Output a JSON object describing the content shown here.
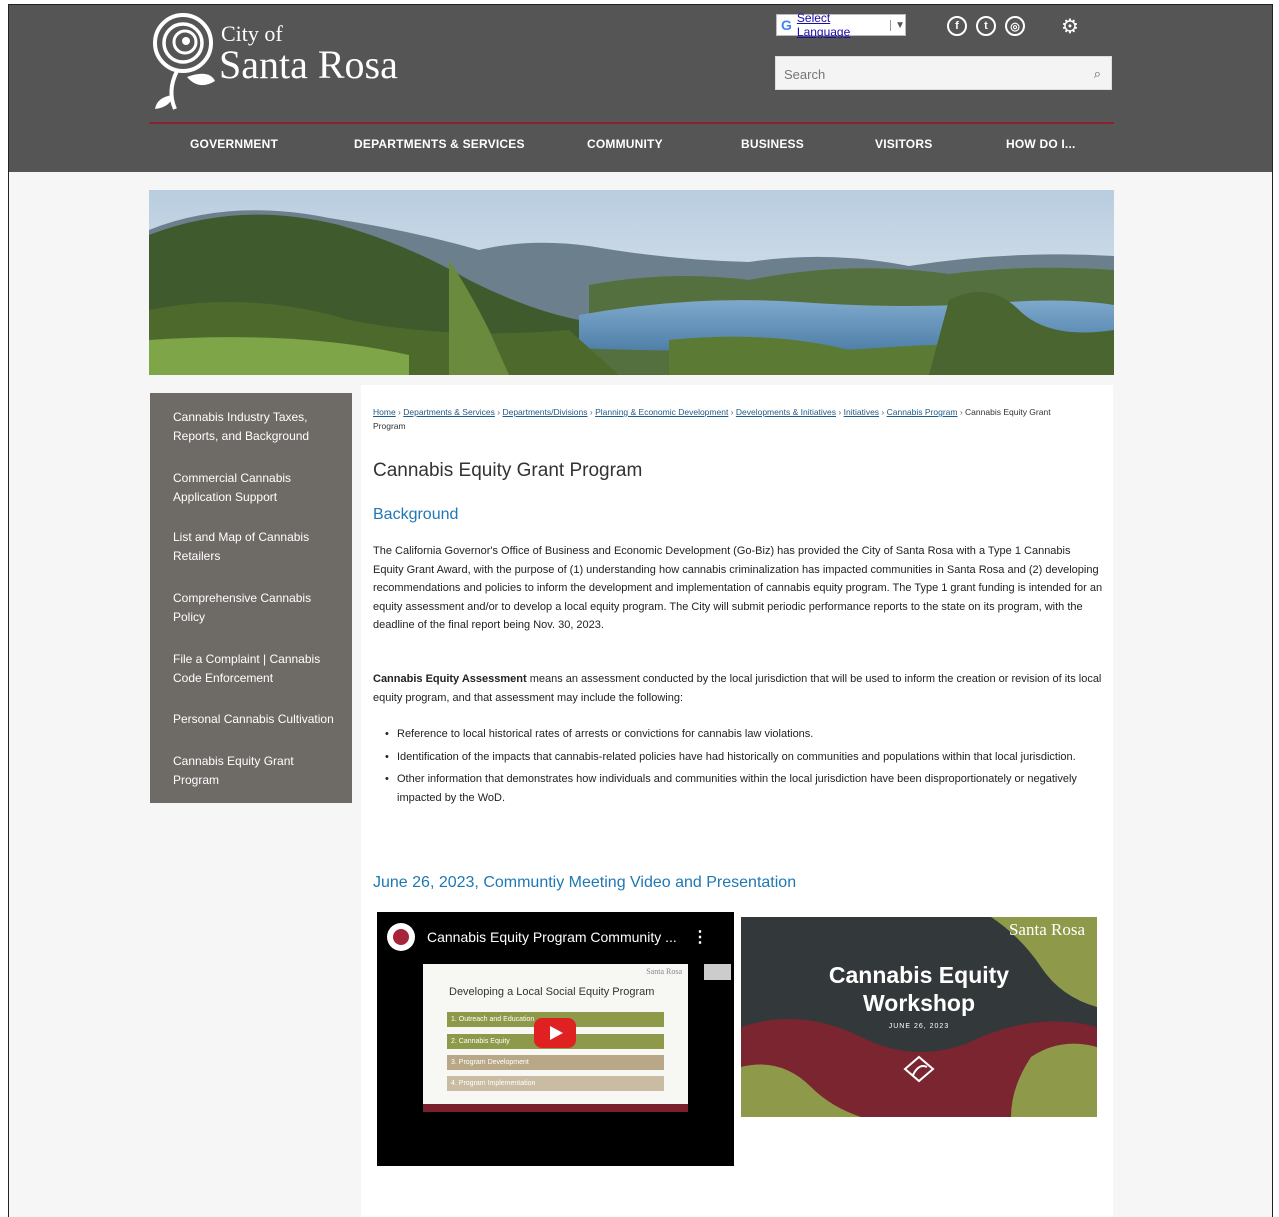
{
  "header": {
    "logo_city": "City of",
    "logo_name": "Santa Rosa",
    "language_label": "Select Language",
    "search_placeholder": "Search",
    "social": [
      {
        "icon": "facebook-icon",
        "glyph": "f"
      },
      {
        "icon": "twitter-icon",
        "glyph": "t"
      },
      {
        "icon": "instagram-icon",
        "glyph": "◎"
      }
    ],
    "settings_icon": "gear-icon"
  },
  "nav": [
    "GOVERNMENT",
    "DEPARTMENTS & SERVICES",
    "COMMUNITY",
    "BUSINESS",
    "VISITORS",
    "HOW DO I..."
  ],
  "sidebar": [
    "Cannabis Industry Taxes, Reports, and Background",
    "Commercial Cannabis Application Support",
    "List and Map of Cannabis Retailers",
    "Comprehensive Cannabis Policy",
    "File a Complaint | Cannabis Code Enforcement",
    "Personal Cannabis Cultivation",
    "Cannabis Equity Grant Program"
  ],
  "breadcrumb": {
    "links": [
      "Home",
      "Departments & Services",
      "Departments/Divisions",
      "Planning & Economic Development",
      "Developments & Initiatives",
      "Initiatives",
      "Cannabis Program"
    ],
    "current": "Cannabis Equity Grant Program"
  },
  "page": {
    "title": "Cannabis Equity Grant Program",
    "background_heading": "Background",
    "background_text": "The California Governor's Office of Business and Economic Development (Go-Biz) has provided the City of Santa Rosa with a Type 1 Cannabis Equity Grant Award, with the purpose of (1) understanding how cannabis criminalization has impacted communities in Santa Rosa and (2) developing recommendations and policies to inform the development and implementation of cannabis equity program. The Type 1 grant funding is intended for an equity assessment and/or to develop a local equity program. The City will submit periodic performance reports to the state on its program, with the deadline of the final report being Nov. 30, 2023.",
    "assessment_bold": "Cannabis Equity Assessment",
    "assessment_text": " means an assessment conducted by the local jurisdiction that will be used to inform the creation or revision of its local equity program, and that assessment may include the following:",
    "bullets": [
      "Reference to local historical rates of arrests or convictions for cannabis law violations.",
      "Identification of the impacts that cannabis-related policies have had historically on communities and populations within that local jurisdiction.",
      "Other information that demonstrates how individuals and communities within the local jurisdiction have been disproportionately or negatively impacted by the WoD."
    ],
    "meeting_heading": "June 26, 2023, Communtiy Meeting Video and Presentation"
  },
  "video": {
    "title": "Cannabis Equity Program Community ...",
    "slide_title": "Developing a Local Social Equity Program",
    "slide_logo": "Santa Rosa",
    "slide_items": [
      "1. Outreach and Education",
      "2. Cannabis Equity",
      "3. Program Development",
      "4. Program Implementation"
    ]
  },
  "workshop": {
    "title_line1": "Cannabis Equity",
    "title_line2": "Workshop",
    "date": "JUNE 26, 2023",
    "logo": "Santa Rosa"
  },
  "colors": {
    "header_bg": "#555555",
    "accent_red": "#8b2232",
    "sidebar_bg": "#6e6a66",
    "heading_blue": "#1f77b4",
    "slide_green": "#8e9a4a",
    "slide_tan": "#b8a888"
  }
}
